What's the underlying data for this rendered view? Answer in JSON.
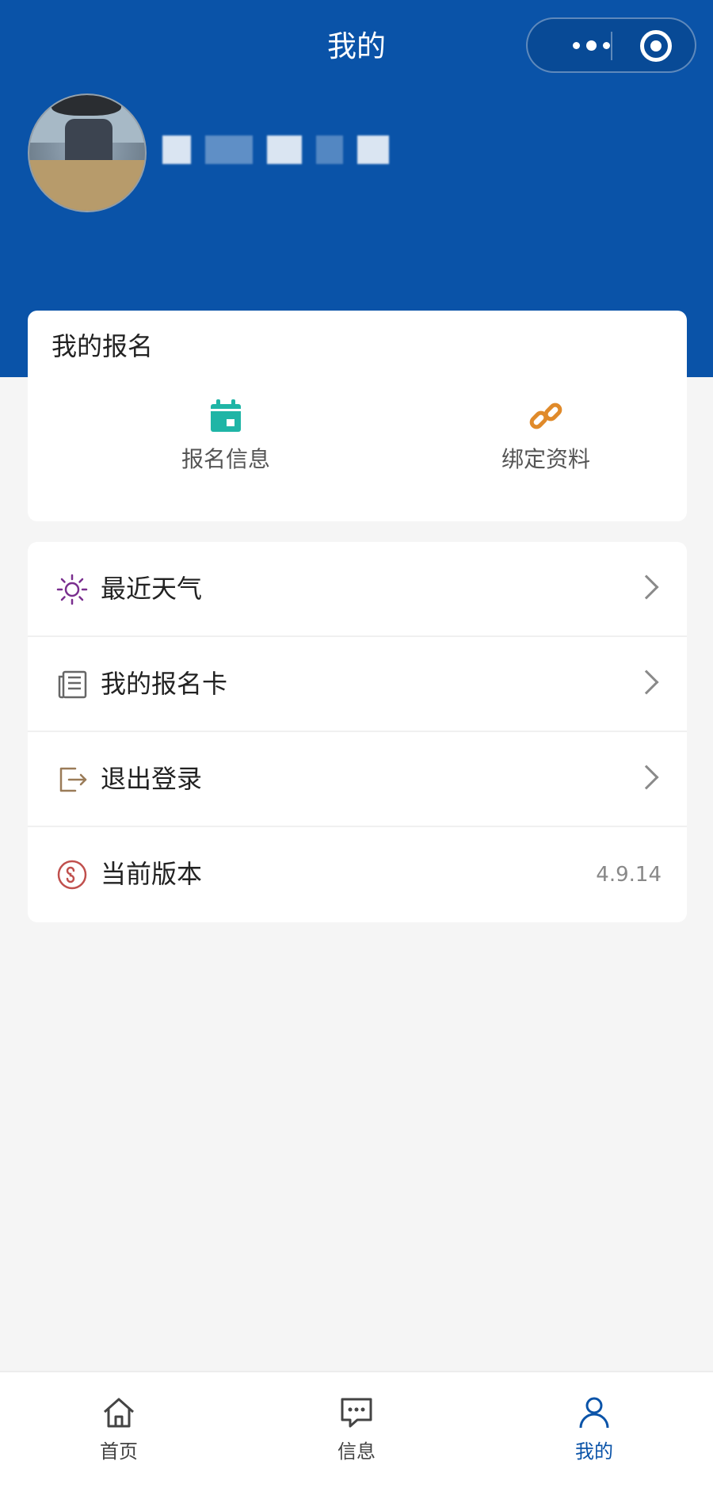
{
  "nav": {
    "title": "我的",
    "capsule": {
      "more_icon": "ellipsis-icon",
      "close_icon": "target-icon"
    }
  },
  "user": {
    "avatar_icon": "avatar-photo"
  },
  "registration": {
    "title": "我的报名",
    "actions": [
      {
        "label": "报名信息",
        "icon": "calendar-icon",
        "color": "#1fb5a6"
      },
      {
        "label": "绑定资料",
        "icon": "link-icon",
        "color": "#e08a2a"
      }
    ]
  },
  "menu": [
    {
      "label": "最近天气",
      "icon": "sun-icon",
      "color": "#7a2f8f",
      "value": ""
    },
    {
      "label": "我的报名卡",
      "icon": "newspaper-icon",
      "color": "#666666",
      "value": ""
    },
    {
      "label": "退出登录",
      "icon": "logout-icon",
      "color": "#9a7b58",
      "value": ""
    },
    {
      "label": "当前版本",
      "icon": "mini-program-icon",
      "color": "#c0504d",
      "value": "4.9.14"
    }
  ],
  "tabbar": {
    "items": [
      {
        "label": "首页",
        "icon": "home-icon",
        "active": false
      },
      {
        "label": "信息",
        "icon": "message-icon",
        "active": false
      },
      {
        "label": "我的",
        "icon": "user-icon",
        "active": true
      }
    ],
    "active_color": "#0a53a8"
  },
  "colors": {
    "header_bg": "#0a53a8",
    "page_bg": "#f5f5f5"
  }
}
